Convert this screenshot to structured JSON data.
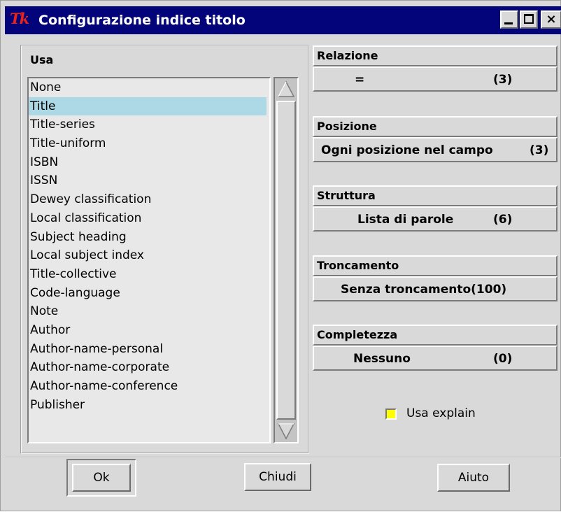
{
  "window": {
    "title": "Configurazione indice titolo",
    "logo_text": "Tk",
    "controls": {
      "close_glyph": "×"
    }
  },
  "usa": {
    "label": "Usa",
    "selected_index": 1,
    "items": [
      "None",
      "Title",
      "Title-series",
      "Title-uniform",
      "ISBN",
      "ISSN",
      "Dewey classification",
      "Local classification",
      "Subject heading",
      "Local subject index",
      "Title-collective",
      "Code-language",
      "Note",
      "Author",
      "Author-name-personal",
      "Author-name-corporate",
      "Author-name-conference",
      "Publisher"
    ]
  },
  "groups": {
    "relazione": {
      "label": "Relazione",
      "value": "=",
      "count": "(3)"
    },
    "posizione": {
      "label": "Posizione",
      "value": "Ogni posizione nel campo",
      "count": "(3)"
    },
    "struttura": {
      "label": "Struttura",
      "value": "Lista di parole",
      "count": "(6)"
    },
    "troncamento": {
      "label": "Troncamento",
      "value": "Senza troncamento(100)"
    },
    "completezza": {
      "label": "Completezza",
      "value": "Nessuno",
      "count": "(0)"
    }
  },
  "explain": {
    "label": "Usa explain",
    "checked": true,
    "color": "#ffff00"
  },
  "buttons": {
    "ok": "Ok",
    "close": "Chiudi",
    "help": "Aiuto"
  },
  "colors": {
    "titlebar": "#03037a",
    "selection": "#add8e6",
    "logo": "#e8231c"
  }
}
